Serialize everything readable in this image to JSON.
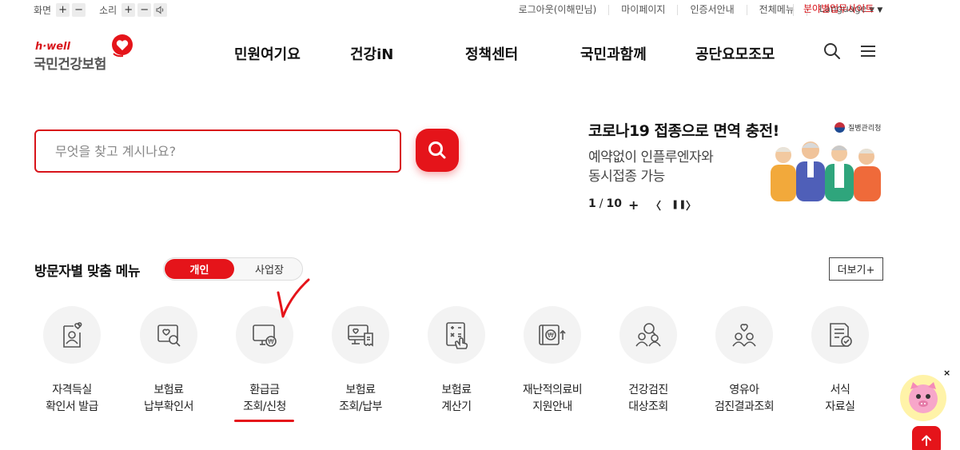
{
  "utility": {
    "screen_label": "화면",
    "sound_label": "소리",
    "plus": "+",
    "minus": "−",
    "links": [
      "로그아웃(이해민님)",
      "마이페이지",
      "인증서안내",
      "전체메뉴"
    ],
    "language": "Language",
    "site_link": "분야별업무사이트",
    "caret": "▼"
  },
  "logo": {
    "brand": "h·well",
    "name": "국민건강보험"
  },
  "gnb": [
    "민원여기요",
    "건강iN",
    "정책센터",
    "국민과함께",
    "공단요모조모"
  ],
  "header_icons": [
    "search-icon",
    "hamburger-menu-icon"
  ],
  "search": {
    "placeholder": "무엇을 찾고 계시나요?",
    "value": ""
  },
  "banner": {
    "title": "코로나19 접종으로 면역 충전!",
    "subtitle_1": "예약없이 인플루엔자와",
    "subtitle_2": "동시접종 가능",
    "agency": "질병관리청",
    "page_current": "1",
    "page_sep": "/",
    "page_total": "10",
    "plus": "+",
    "prev": "〈",
    "pause": "❚❚",
    "next": "〉"
  },
  "visitor_menu": {
    "title": "방문자별 맞춤 메뉴",
    "tab_personal": "개인",
    "tab_business": "사업장",
    "more": "더보기+",
    "items": [
      {
        "line1": "자격득실",
        "line2": "확인서 발급",
        "icon": "id-card-heart-icon"
      },
      {
        "line1": "보험료",
        "line2": "납부확인서",
        "icon": "document-search-icon"
      },
      {
        "line1": "환급금",
        "line2": "조회/신청",
        "icon": "monitor-won-icon"
      },
      {
        "line1": "보험료",
        "line2": "조회/납부",
        "icon": "monitor-receipt-icon"
      },
      {
        "line1": "보험료",
        "line2": "계산기",
        "icon": "calculator-hand-icon"
      },
      {
        "line1": "재난적의료비",
        "line2": "지원안내",
        "icon": "wallet-won-up-icon"
      },
      {
        "line1": "건강검진",
        "line2": "대상조회",
        "icon": "people-search-icon"
      },
      {
        "line1": "영유아",
        "line2": "검진결과조회",
        "icon": "family-heart-icon"
      },
      {
        "line1": "서식",
        "line2": "자료실",
        "icon": "form-check-icon"
      }
    ]
  },
  "floaters": {
    "close": "×",
    "top_arrow": "↑"
  },
  "colors": {
    "accent": "#e5141a",
    "text": "#222222",
    "icon_bg": "#f3f3f3"
  }
}
